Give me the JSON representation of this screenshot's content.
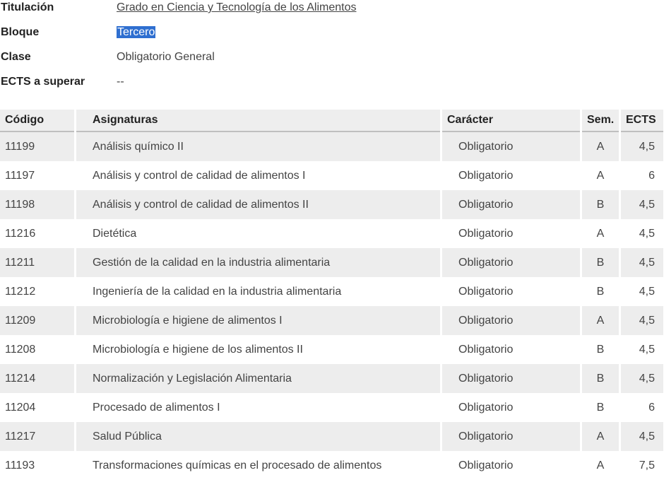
{
  "info": {
    "titulacion_label": "Titulación",
    "titulacion_value": "Grado en Ciencia y Tecnología de los Alimentos",
    "bloque_label": "Bloque",
    "bloque_value": "Tercero",
    "clase_label": "Clase",
    "clase_value": "Obligatorio General",
    "ects_label": "ECTS a superar",
    "ects_value": "--"
  },
  "table": {
    "headers": {
      "codigo": "Código",
      "asignaturas": "Asignaturas",
      "caracter": "Carácter",
      "sem": "Sem.",
      "ects": "ECTS"
    },
    "rows": [
      {
        "codigo": "11199",
        "asignatura": "Análisis químico II",
        "caracter": "Obligatorio",
        "sem": "A",
        "ects": "4,5"
      },
      {
        "codigo": "11197",
        "asignatura": "Análisis y control de calidad de alimentos I",
        "caracter": "Obligatorio",
        "sem": "A",
        "ects": "6"
      },
      {
        "codigo": "11198",
        "asignatura": "Análisis y control de calidad de alimentos II",
        "caracter": "Obligatorio",
        "sem": "B",
        "ects": "4,5"
      },
      {
        "codigo": "11216",
        "asignatura": "Dietética",
        "caracter": "Obligatorio",
        "sem": "A",
        "ects": "4,5"
      },
      {
        "codigo": "11211",
        "asignatura": "Gestión de la calidad en la industria alimentaria",
        "caracter": "Obligatorio",
        "sem": "B",
        "ects": "4,5"
      },
      {
        "codigo": "11212",
        "asignatura": "Ingeniería de la calidad en la industria alimentaria",
        "caracter": "Obligatorio",
        "sem": "B",
        "ects": "4,5"
      },
      {
        "codigo": "11209",
        "asignatura": "Microbiología e higiene de alimentos I",
        "caracter": "Obligatorio",
        "sem": "A",
        "ects": "4,5"
      },
      {
        "codigo": "11208",
        "asignatura": "Microbiología e higiene de los alimentos II",
        "caracter": "Obligatorio",
        "sem": "B",
        "ects": "4,5"
      },
      {
        "codigo": "11214",
        "asignatura": "Normalización y Legislación Alimentaria",
        "caracter": "Obligatorio",
        "sem": "B",
        "ects": "4,5"
      },
      {
        "codigo": "11204",
        "asignatura": "Procesado de alimentos I",
        "caracter": "Obligatorio",
        "sem": "B",
        "ects": "6"
      },
      {
        "codigo": "11217",
        "asignatura": "Salud Pública",
        "caracter": "Obligatorio",
        "sem": "A",
        "ects": "4,5"
      },
      {
        "codigo": "11193",
        "asignatura": "Transformaciones químicas en el procesado de alimentos",
        "caracter": "Obligatorio",
        "sem": "A",
        "ects": "7,5"
      }
    ]
  }
}
